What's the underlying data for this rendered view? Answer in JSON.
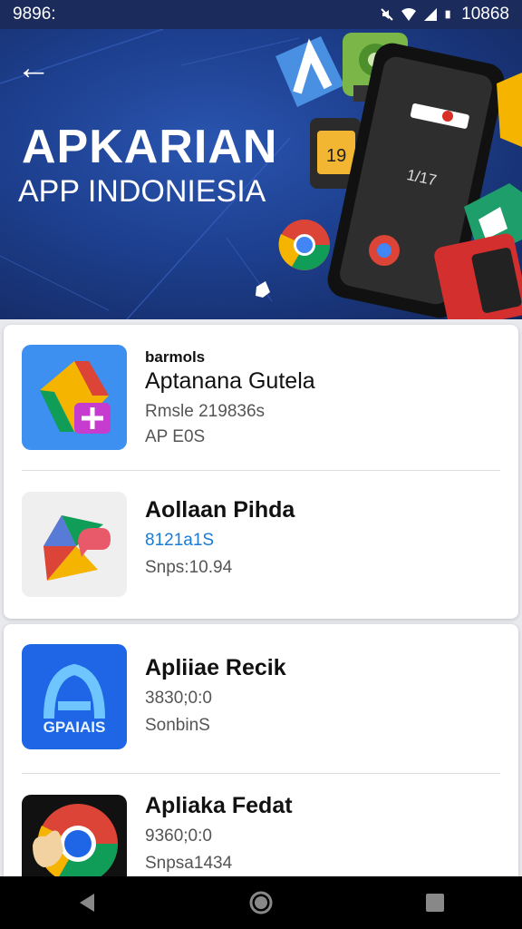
{
  "status_bar": {
    "time": "9896:",
    "battery": "10868",
    "icons": [
      "mute-icon",
      "wifi-icon",
      "signal-icon",
      "battery-icon"
    ]
  },
  "hero": {
    "back_icon": "arrow-left-icon",
    "back_glyph": "←",
    "title": "APKARIAN",
    "subtitle": "APP INDONIESIA",
    "phone_badge": "19",
    "phone_text": "1/17"
  },
  "apps": [
    {
      "kicker": "barmols",
      "name": "Aptanana Gutela",
      "meta1": "Rmsle 219836s",
      "meta2": "AP E0S",
      "icon": "drive-plus-icon"
    },
    {
      "kicker": "",
      "name": "Aollaan Pihda",
      "meta1": "8121a1S",
      "meta2": "Snps:10.94",
      "icon": "maps-chat-icon"
    },
    {
      "kicker": "",
      "name": "Apliiae Recik",
      "meta1": "3830;0:0",
      "meta2": "SonbinS",
      "icon": "a-logo-icon",
      "icon_label": "GPAIAIS"
    },
    {
      "kicker": "",
      "name": "Apliaka Fedat",
      "meta1": "9360;0:0",
      "meta2": "Snpsa1434",
      "icon": "chrome-hand-icon"
    }
  ],
  "nav": {
    "back": "nav-back-icon",
    "home": "nav-home-icon",
    "recents": "nav-recents-icon"
  },
  "colors": {
    "hero_bg": "#1d3f8e",
    "link_blue": "#1a7bd6",
    "status_bg": "#1a2b5c"
  }
}
